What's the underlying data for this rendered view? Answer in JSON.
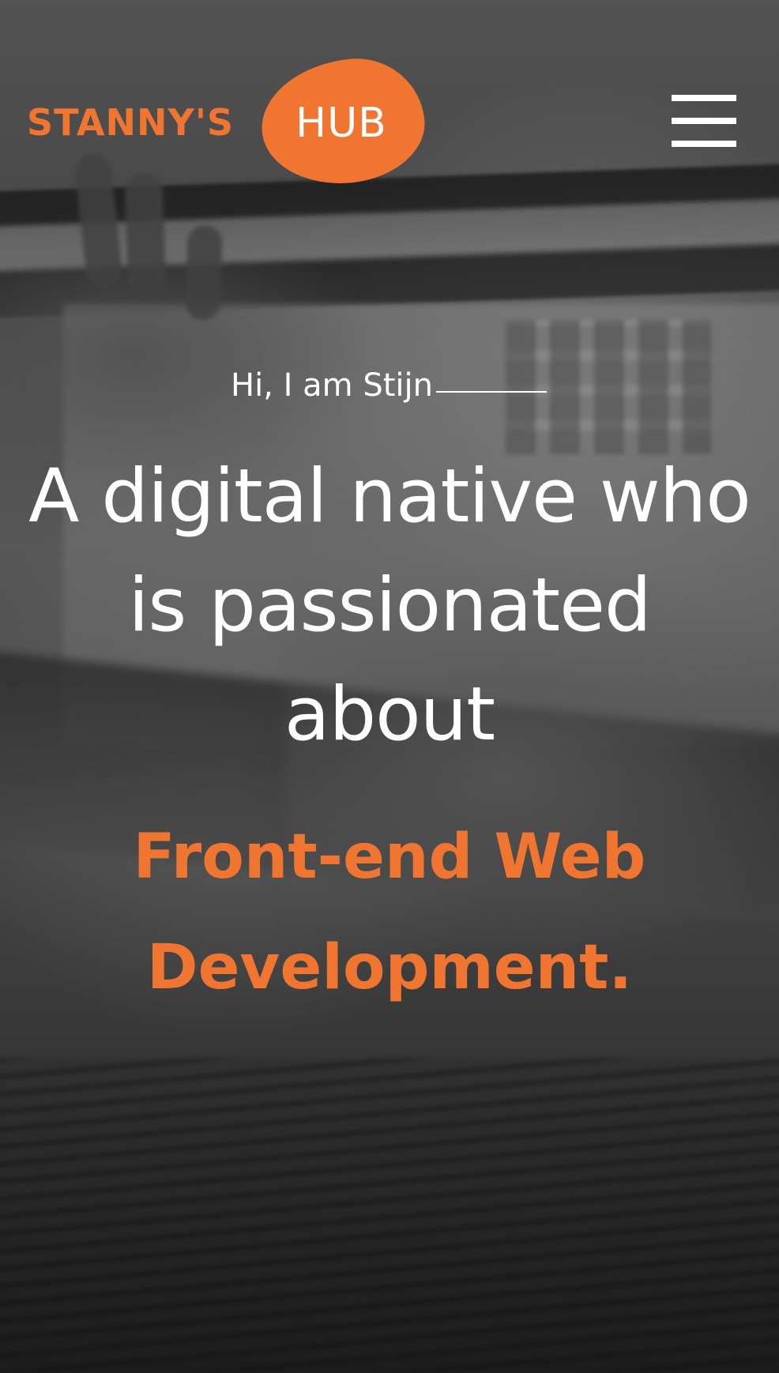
{
  "brand": {
    "name_text": "STANNY'S",
    "badge_text": "HUB",
    "accent_color": "#f07530"
  },
  "header": {
    "menu_icon": "hamburger-menu-icon"
  },
  "hero": {
    "intro": "Hi, I am Stijn",
    "headline_lines": [
      "A digital native who",
      "is passionated",
      "about"
    ],
    "subline_lines": [
      "Front-end Web",
      "Development."
    ],
    "text_color": "#ffffff"
  }
}
